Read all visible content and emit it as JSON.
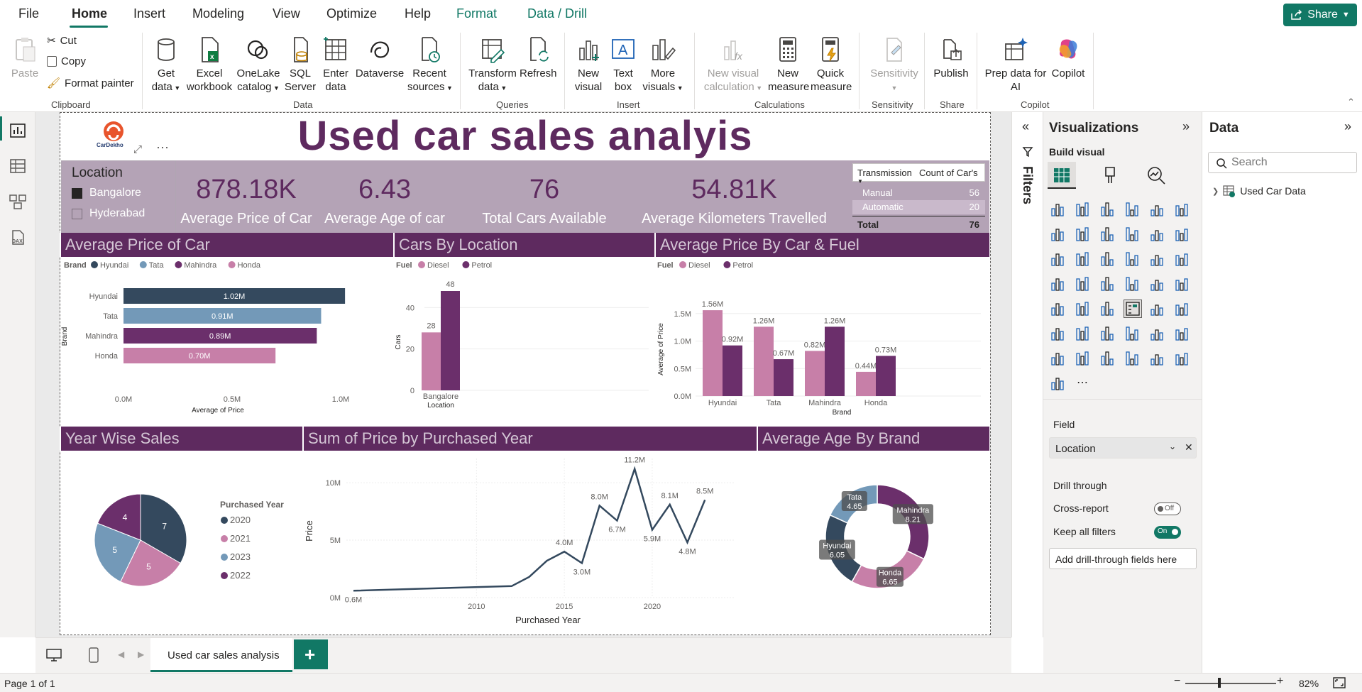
{
  "menu": {
    "file": "File",
    "home": "Home",
    "insert": "Insert",
    "modeling": "Modeling",
    "view": "View",
    "optimize": "Optimize",
    "help": "Help",
    "format": "Format",
    "data_drill": "Data / Drill",
    "share": "Share"
  },
  "ribbon": {
    "clipboard": {
      "paste": "Paste",
      "cut": "Cut",
      "copy": "Copy",
      "format_painter": "Format painter",
      "label": "Clipboard"
    },
    "data": {
      "get_data": [
        "Get",
        "data"
      ],
      "excel": [
        "Excel",
        "workbook"
      ],
      "onelake": [
        "OneLake",
        "catalog"
      ],
      "sql": [
        "SQL",
        "Server"
      ],
      "enter": [
        "Enter",
        "data"
      ],
      "dataverse": "Dataverse",
      "recent": [
        "Recent",
        "sources"
      ],
      "label": "Data"
    },
    "queries": {
      "transform": [
        "Transform",
        "data"
      ],
      "refresh": "Refresh",
      "label": "Queries"
    },
    "insert": {
      "new_visual": [
        "New",
        "visual"
      ],
      "text_box": [
        "Text",
        "box"
      ],
      "more_visuals": [
        "More",
        "visuals"
      ],
      "label": "Insert"
    },
    "calculations": {
      "new_visual_calc": [
        "New visual",
        "calculation"
      ],
      "new_measure": [
        "New",
        "measure"
      ],
      "quick_measure": [
        "Quick",
        "measure"
      ],
      "label": "Calculations"
    },
    "sensitivity": {
      "sensitivity": "Sensitivity",
      "label": "Sensitivity"
    },
    "share": {
      "publish": "Publish",
      "label": "Share"
    },
    "copilot": {
      "prep": [
        "Prep data for",
        "AI"
      ],
      "copilot": "Copilot",
      "label": "Copilot"
    }
  },
  "report": {
    "title": "Used car sales analyis",
    "logo_text": "CarDekho",
    "slicer": {
      "title": "Location",
      "items": [
        {
          "label": "Bangalore",
          "checked": true
        },
        {
          "label": "Hyderabad",
          "checked": false
        }
      ]
    },
    "kpis": [
      {
        "value": "878.18K",
        "label": "Average Price of Car"
      },
      {
        "value": "6.43",
        "label": "Average Age of car"
      },
      {
        "value": "76",
        "label": "Total Cars Available"
      },
      {
        "value": "54.81K",
        "label": "Average Kilometers Travelled"
      }
    ],
    "transmission_table": {
      "headers": [
        "Transmission",
        "Count of Car's"
      ],
      "rows": [
        [
          "Manual",
          "56"
        ],
        [
          "Automatic",
          "20"
        ]
      ],
      "total": [
        "Total",
        "76"
      ]
    },
    "headers": {
      "avg_price_car": "Average Price of Car",
      "cars_by_location": "Cars By Location",
      "avg_price_car_fuel": "Average Price By Car & Fuel",
      "year_wise": "Year Wise Sales",
      "sum_price_year": "Sum of Price by Purchased Year",
      "avg_age_brand": "Average Age By Brand"
    }
  },
  "colors": {
    "hyundai": "#34495e",
    "tata": "#7399b8",
    "mahindra": "#6b2f6b",
    "honda": "#c77fa8",
    "diesel": "#c77fa8",
    "petrol": "#6b2f6b",
    "accent": "#117865",
    "header_bg": "#5e2a5f"
  },
  "chart_data": [
    {
      "type": "bar",
      "orientation": "horizontal",
      "legend_title": "Brand",
      "categories": [
        "Hyundai",
        "Tata",
        "Mahindra",
        "Honda"
      ],
      "values": [
        1.02,
        0.91,
        0.89,
        0.7
      ],
      "value_labels": [
        "1.02M",
        "0.91M",
        "0.89M",
        "0.70M"
      ],
      "xlabel": "Average of Price",
      "ylabel": "Brand",
      "xticks": [
        "0.0M",
        "0.5M",
        "1.0M"
      ],
      "xlim": [
        0,
        1.0
      ],
      "legend": "top-left"
    },
    {
      "type": "bar",
      "legend_title": "Fuel",
      "categories": [
        "Bangalore"
      ],
      "series": [
        {
          "name": "Diesel",
          "values": [
            28
          ]
        },
        {
          "name": "Petrol",
          "values": [
            48
          ]
        }
      ],
      "xlabel": "Location",
      "ylabel": "Cars",
      "yticks": [
        "0",
        "20",
        "40"
      ],
      "ylim": [
        0,
        48
      ],
      "legend": "top-left"
    },
    {
      "type": "bar",
      "legend_title": "Fuel",
      "categories": [
        "Hyundai",
        "Tata",
        "Mahindra",
        "Honda"
      ],
      "series": [
        {
          "name": "Diesel",
          "values": [
            1.56,
            1.26,
            0.82,
            0.44
          ],
          "labels": [
            "1.56M",
            "1.26M",
            "0.82M",
            "0.44M"
          ]
        },
        {
          "name": "Petrol",
          "values": [
            0.92,
            0.67,
            1.26,
            0.73
          ],
          "labels": [
            "0.92M",
            "0.67M",
            "1.26M",
            "0.73M"
          ]
        }
      ],
      "xlabel": "Brand",
      "ylabel": "Average of Price",
      "yticks": [
        "0.0M",
        "0.5M",
        "1.0M",
        "1.5M"
      ],
      "ylim": [
        0,
        1.6
      ],
      "legend": "top-left"
    },
    {
      "type": "pie",
      "legend_title": "Purchased Year",
      "labels": [
        "2020",
        "2021",
        "2023",
        "2022"
      ],
      "values": [
        7,
        5,
        5,
        4
      ],
      "legend": "right"
    },
    {
      "type": "line",
      "x": [
        2003,
        2012,
        2013,
        2014,
        2015,
        2016,
        2017,
        2018,
        2019,
        2020,
        2021,
        2022,
        2023
      ],
      "y": [
        0.6,
        1.0,
        1.8,
        3.2,
        4.0,
        3.0,
        8.0,
        6.7,
        11.2,
        5.9,
        8.1,
        4.8,
        8.5
      ],
      "point_labels": [
        [
          "0.6M",
          0
        ],
        [
          "4.0M",
          4
        ],
        [
          "3.0M",
          5
        ],
        [
          "8.0M",
          6
        ],
        [
          "6.7M",
          7
        ],
        [
          "11.2M",
          8
        ],
        [
          "5.9M",
          9
        ],
        [
          "8.1M",
          10
        ],
        [
          "4.8M",
          11
        ],
        [
          "8.5M",
          12
        ]
      ],
      "xlabel": "Purchased Year",
      "ylabel": "Price",
      "xticks": [
        "2010",
        "2015",
        "2020"
      ],
      "yticks": [
        "0M",
        "5M",
        "10M"
      ],
      "ylim": [
        0,
        11.5
      ],
      "xlim": [
        2003,
        2024
      ]
    },
    {
      "type": "pie",
      "variant": "donut",
      "labels": [
        "Mahindra",
        "Honda",
        "Hyundai",
        "Tata"
      ],
      "values": [
        8.21,
        6.65,
        6.05,
        4.65
      ]
    }
  ],
  "vis_pane": {
    "title": "Visualizations",
    "build_visual": "Build visual",
    "field_label": "Field",
    "field_value": "Location",
    "drill_through": "Drill through",
    "cross_report": "Cross-report",
    "cross_report_state": "Off",
    "keep_filters": "Keep all filters",
    "keep_filters_state": "On",
    "add_drill": "Add drill-through fields here"
  },
  "filters_label": "Filters",
  "data_pane": {
    "title": "Data",
    "search_placeholder": "Search",
    "table": "Used Car Data"
  },
  "page_tab": "Used car sales analysis",
  "status": {
    "page": "Page 1 of 1",
    "zoom": "82%"
  }
}
